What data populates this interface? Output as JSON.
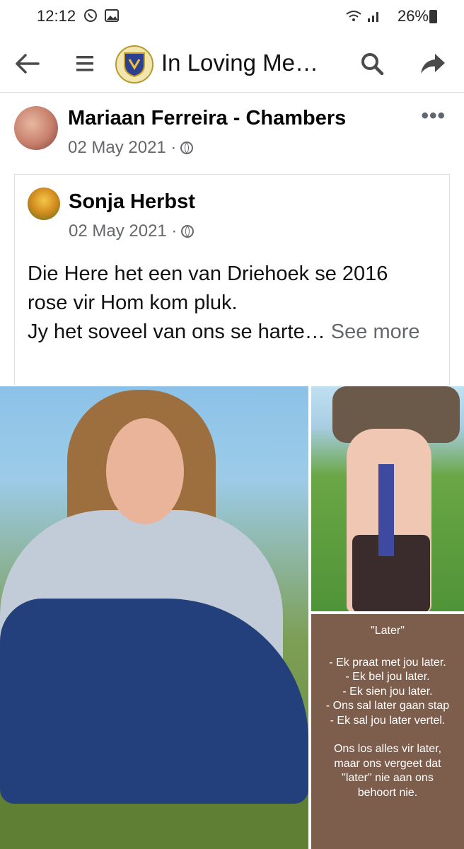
{
  "status_bar": {
    "time": "12:12",
    "battery": "26%"
  },
  "top_bar": {
    "title": "In Loving Me…",
    "icons": [
      "back-arrow-icon",
      "menu-icon",
      "group-logo-icon",
      "search-icon",
      "share-icon"
    ]
  },
  "post": {
    "author": "Mariaan Ferreira - Chambers",
    "date": "02 May 2021 ·",
    "more_label": "•••",
    "shared": {
      "author": "Sonja Herbst",
      "date": "02 May 2021 ·",
      "text_line1": "Die Here het een van Driehoek se 2016",
      "text_line2": "rose vir Hom kom pluk.",
      "text_line3": "Jy het soveel van ons se harte…",
      "see_more": "See more"
    }
  },
  "poem": {
    "title": "\"Later\"",
    "lines": [
      "- Ek praat met jou later.",
      "- Ek bel jou later.",
      "- Ek sien jou later.",
      "- Ons sal later gaan stap",
      "- Ek sal jou later vertel."
    ],
    "ending": [
      "Ons los alles vir later,",
      "maar ons vergeet dat",
      "\"later\" nie aan ons",
      "behoort nie."
    ]
  }
}
